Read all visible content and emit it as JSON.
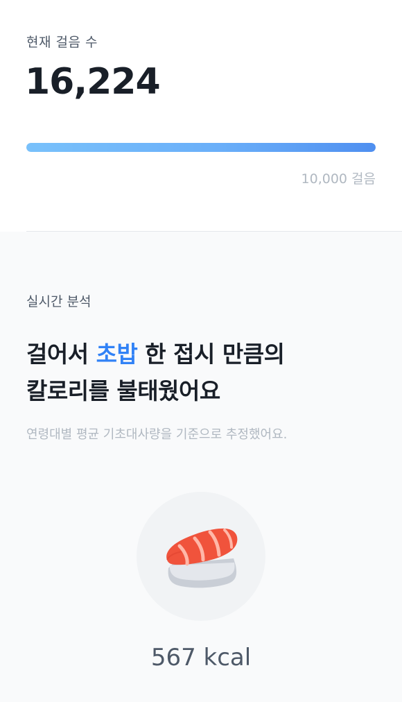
{
  "steps": {
    "label": "현재 걸음 수",
    "value": "16,224",
    "progress_fraction": 1.0,
    "goal_label": "10,000 걸음"
  },
  "analysis": {
    "label": "실시간 분석",
    "headline": {
      "prefix": "걸어서 ",
      "food": "초밥",
      "suffix_line1": " 한 접시 만큼의",
      "line2": "칼로리를 불태웠어요"
    },
    "subtext": "연령대별 평균 기초대사량을 기준으로 추정했어요.",
    "food_icon": "sushi-icon",
    "kcal": "567 kcal"
  },
  "colors": {
    "accent": "#3182f6",
    "progress_start": "#79c1fb",
    "progress_end": "#4f8ff0",
    "salmon": "#f0533c"
  }
}
